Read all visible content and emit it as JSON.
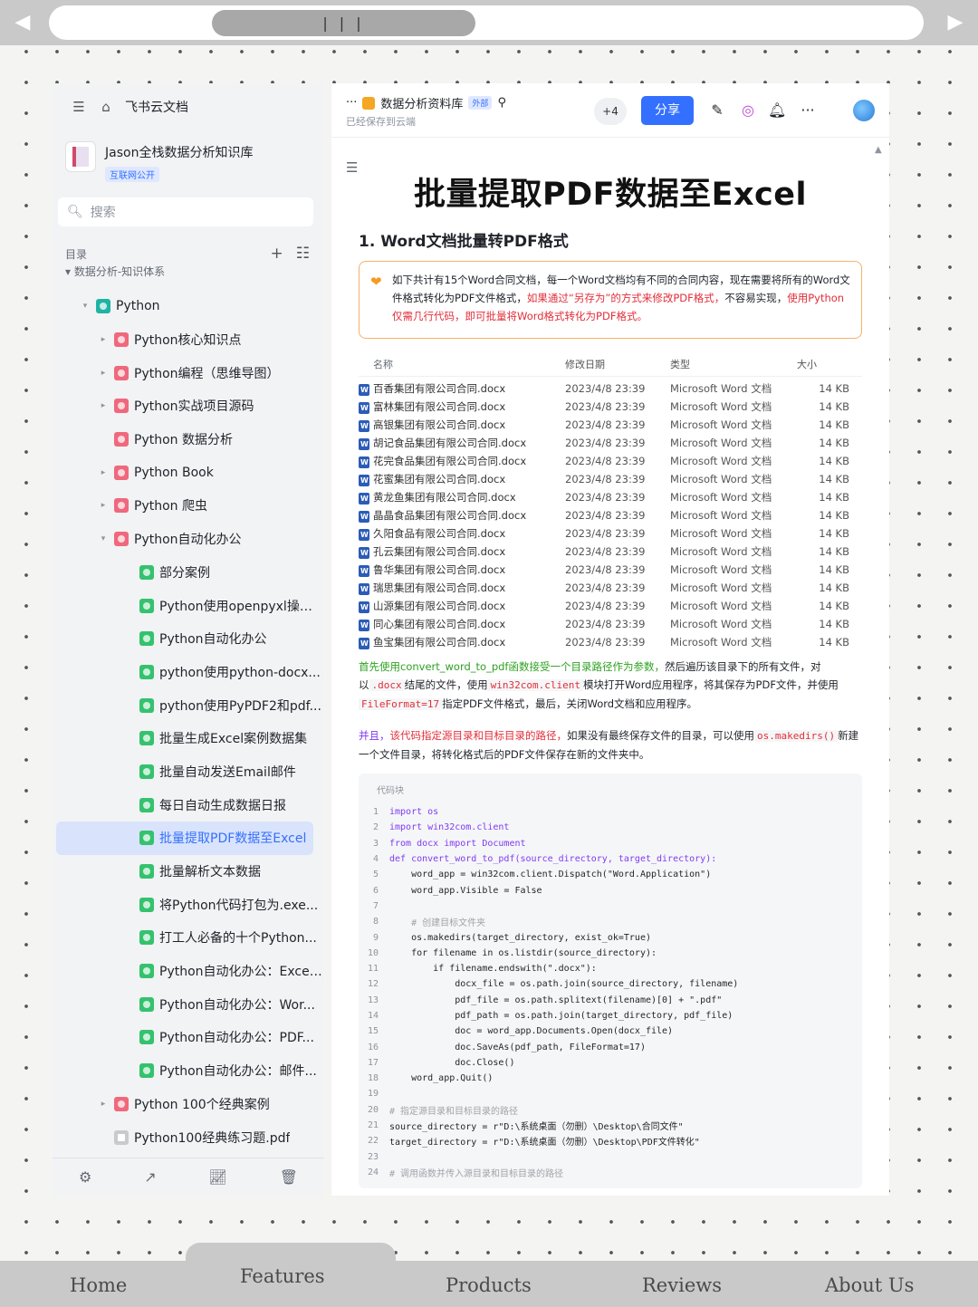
{
  "browser": {
    "back_icon": "triangle-left-icon",
    "forward_icon": "triangle-right-icon",
    "scroll_grip": "| | |"
  },
  "sidebar": {
    "brand": "飞书云文档",
    "kb_title": "Jason全栈数据分析知识库",
    "kb_tag": "互联网公开",
    "search_placeholder": "搜索",
    "toc_label": "目录",
    "cut_item": "数据分析-知识体系",
    "items": [
      {
        "label": "Python",
        "arrow": "▾",
        "icon": "teal"
      },
      {
        "label": "Python核心知识点",
        "arrow": "▸",
        "icon": "red"
      },
      {
        "label": "Python编程（思维导图）",
        "arrow": "▸",
        "icon": "red"
      },
      {
        "label": "Python实战项目源码",
        "arrow": "▸",
        "icon": "red"
      },
      {
        "label": "Python 数据分析",
        "arrow": "",
        "icon": "red"
      },
      {
        "label": "Python Book",
        "arrow": "▸",
        "icon": "red"
      },
      {
        "label": "Python 爬虫",
        "arrow": "▸",
        "icon": "red"
      },
      {
        "label": "Python自动化办公",
        "arrow": "▾",
        "icon": "red"
      },
      {
        "label": "部分案例",
        "arrow": "",
        "icon": "green"
      },
      {
        "label": "Python使用openpyxl操作...",
        "arrow": "",
        "icon": "green"
      },
      {
        "label": "Python自动化办公",
        "arrow": "",
        "icon": "green"
      },
      {
        "label": "python使用python-docx...",
        "arrow": "",
        "icon": "green"
      },
      {
        "label": "python使用PyPDF2和pdf...",
        "arrow": "",
        "icon": "green"
      },
      {
        "label": "批量生成Excel案例数据集",
        "arrow": "",
        "icon": "green"
      },
      {
        "label": "批量自动发送Email邮件",
        "arrow": "",
        "icon": "green"
      },
      {
        "label": "每日自动生成数据日报",
        "arrow": "",
        "icon": "green"
      },
      {
        "label": "批量提取PDF数据至Excel",
        "arrow": "",
        "icon": "green",
        "active": true
      },
      {
        "label": "批量解析文本数据",
        "arrow": "",
        "icon": "green"
      },
      {
        "label": "将Python代码打包为.exe...",
        "arrow": "",
        "icon": "green"
      },
      {
        "label": "打工人必备的十个Python...",
        "arrow": "",
        "icon": "green"
      },
      {
        "label": "Python自动化办公：Excel...",
        "arrow": "",
        "icon": "green"
      },
      {
        "label": "Python自动化办公：Wor...",
        "arrow": "",
        "icon": "green"
      },
      {
        "label": "Python自动化办公：PDF...",
        "arrow": "",
        "icon": "green"
      },
      {
        "label": "Python自动化办公：邮件...",
        "arrow": "",
        "icon": "green"
      },
      {
        "label": "Python 100个经典案例",
        "arrow": "▸",
        "icon": "red"
      },
      {
        "label": "Python100经典练习题.pdf",
        "arrow": "",
        "icon": "gray"
      }
    ],
    "footer_icons": [
      "gear-icon",
      "share-icon",
      "chart-icon",
      "trash-icon"
    ]
  },
  "header": {
    "ellipsis": "···",
    "library": "数据分析资料库",
    "external_tag": "外部",
    "saved": "已经保存到云端",
    "collaborators": "+4",
    "share": "分享"
  },
  "doc": {
    "title": "批量提取PDF数据至Excel",
    "h2": "1. Word文档批量转PDF格式",
    "callout": {
      "p1": "如下共计有15个Word合同文档，每一个Word文档均有不同的合同内容，现在需要将所有的Word文件格式转化为PDF文件格式，",
      "p2": "如果通过“另存为”的方式来修改PDF格式，",
      "p3": "不容易实现，",
      "p4": "使用Python仅需几行代码，即可批量将Word格式转化为PDF格式。"
    },
    "table": {
      "headers": [
        "名称",
        "修改日期",
        "类型",
        "大小"
      ],
      "rows": [
        [
          "百香集团有限公司合同.docx",
          "2023/4/8 23:39",
          "Microsoft Word 文档",
          "14 KB"
        ],
        [
          "富林集团有限公司合同.docx",
          "2023/4/8 23:39",
          "Microsoft Word 文档",
          "14 KB"
        ],
        [
          "高银集团有限公司合同.docx",
          "2023/4/8 23:39",
          "Microsoft Word 文档",
          "14 KB"
        ],
        [
          "胡记食品集团有限公司合同.docx",
          "2023/4/8 23:39",
          "Microsoft Word 文档",
          "14 KB"
        ],
        [
          "花完食品集团有限公司合同.docx",
          "2023/4/8 23:39",
          "Microsoft Word 文档",
          "14 KB"
        ],
        [
          "花蜜集团有限公司合同.docx",
          "2023/4/8 23:39",
          "Microsoft Word 文档",
          "14 KB"
        ],
        [
          "黄龙鱼集团有限公司合同.docx",
          "2023/4/8 23:39",
          "Microsoft Word 文档",
          "14 KB"
        ],
        [
          "晶晶食品集团有限公司合同.docx",
          "2023/4/8 23:39",
          "Microsoft Word 文档",
          "14 KB"
        ],
        [
          "久阳食品有限公司合同.docx",
          "2023/4/8 23:39",
          "Microsoft Word 文档",
          "14 KB"
        ],
        [
          "孔云集团有限公司合同.docx",
          "2023/4/8 23:39",
          "Microsoft Word 文档",
          "14 KB"
        ],
        [
          "鲁华集团有限公司合同.docx",
          "2023/4/8 23:39",
          "Microsoft Word 文档",
          "14 KB"
        ],
        [
          "瑞思集团有限公司合同.docx",
          "2023/4/8 23:39",
          "Microsoft Word 文档",
          "14 KB"
        ],
        [
          "山源集团有限公司合同.docx",
          "2023/4/8 23:39",
          "Microsoft Word 文档",
          "14 KB"
        ],
        [
          "同心集团有限公司合同.docx",
          "2023/4/8 23:39",
          "Microsoft Word 文档",
          "14 KB"
        ],
        [
          "鱼宝集团有限公司合同.docx",
          "2023/4/8 23:39",
          "Microsoft Word 文档",
          "14 KB"
        ]
      ]
    },
    "para1": {
      "a": "首先使用convert_word_to_pdf函数接受一个目录路径作为参数，",
      "b": "然后遍历该目录下的所有文件，对以",
      "c": ".docx",
      "d": "结尾的文件，使用",
      "e": "win32com.client",
      "f": "模块打开Word应用程序，将其保存为PDF文件，并使用",
      "g": "FileFormat=17",
      "h": "指定PDF文件格式，最后，关闭Word文档和应用程序。"
    },
    "para2": {
      "a": "并且，",
      "b": "该代码指定源目录和目标目录的路径，",
      "c": "如果没有最终保存文件的目录，可以使用",
      "d": "os.makedirs()",
      "e": "新建一个文件目录，将转化格式后的PDF文件保存在新的文件夹中。"
    },
    "code_label": "代码块",
    "code": [
      "import os",
      "import win32com.client",
      "from docx import Document",
      "def convert_word_to_pdf(source_directory, target_directory):",
      "    word_app = win32com.client.Dispatch(\"Word.Application\")",
      "    word_app.Visible = False",
      "",
      "    # 创建目标文件夹",
      "    os.makedirs(target_directory, exist_ok=True)",
      "    for filename in os.listdir(source_directory):",
      "        if filename.endswith(\".docx\"):",
      "            docx_file = os.path.join(source_directory, filename)",
      "            pdf_file = os.path.splitext(filename)[0] + \".pdf\"",
      "            pdf_path = os.path.join(target_directory, pdf_file)",
      "            doc = word_app.Documents.Open(docx_file)",
      "            doc.SaveAs(pdf_path, FileFormat=17)",
      "            doc.Close()",
      "    word_app.Quit()",
      "",
      "# 指定源目录和目标目录的路径",
      "source_directory = r\"D:\\系统桌面（勿删）\\Desktop\\合同文件\"",
      "target_directory = r\"D:\\系统桌面（勿删）\\Desktop\\PDF文件转化\"",
      "",
      "# 调用函数并传入源目录和目标目录的路径"
    ]
  },
  "bottom_nav": [
    "Home",
    "Features",
    "Products",
    "Reviews",
    "About Us"
  ],
  "colors": {
    "accent": "#3370ff",
    "callout_border": "#f2b36a",
    "highlight_red": "#e22e39",
    "highlight_green": "#2ea121"
  }
}
